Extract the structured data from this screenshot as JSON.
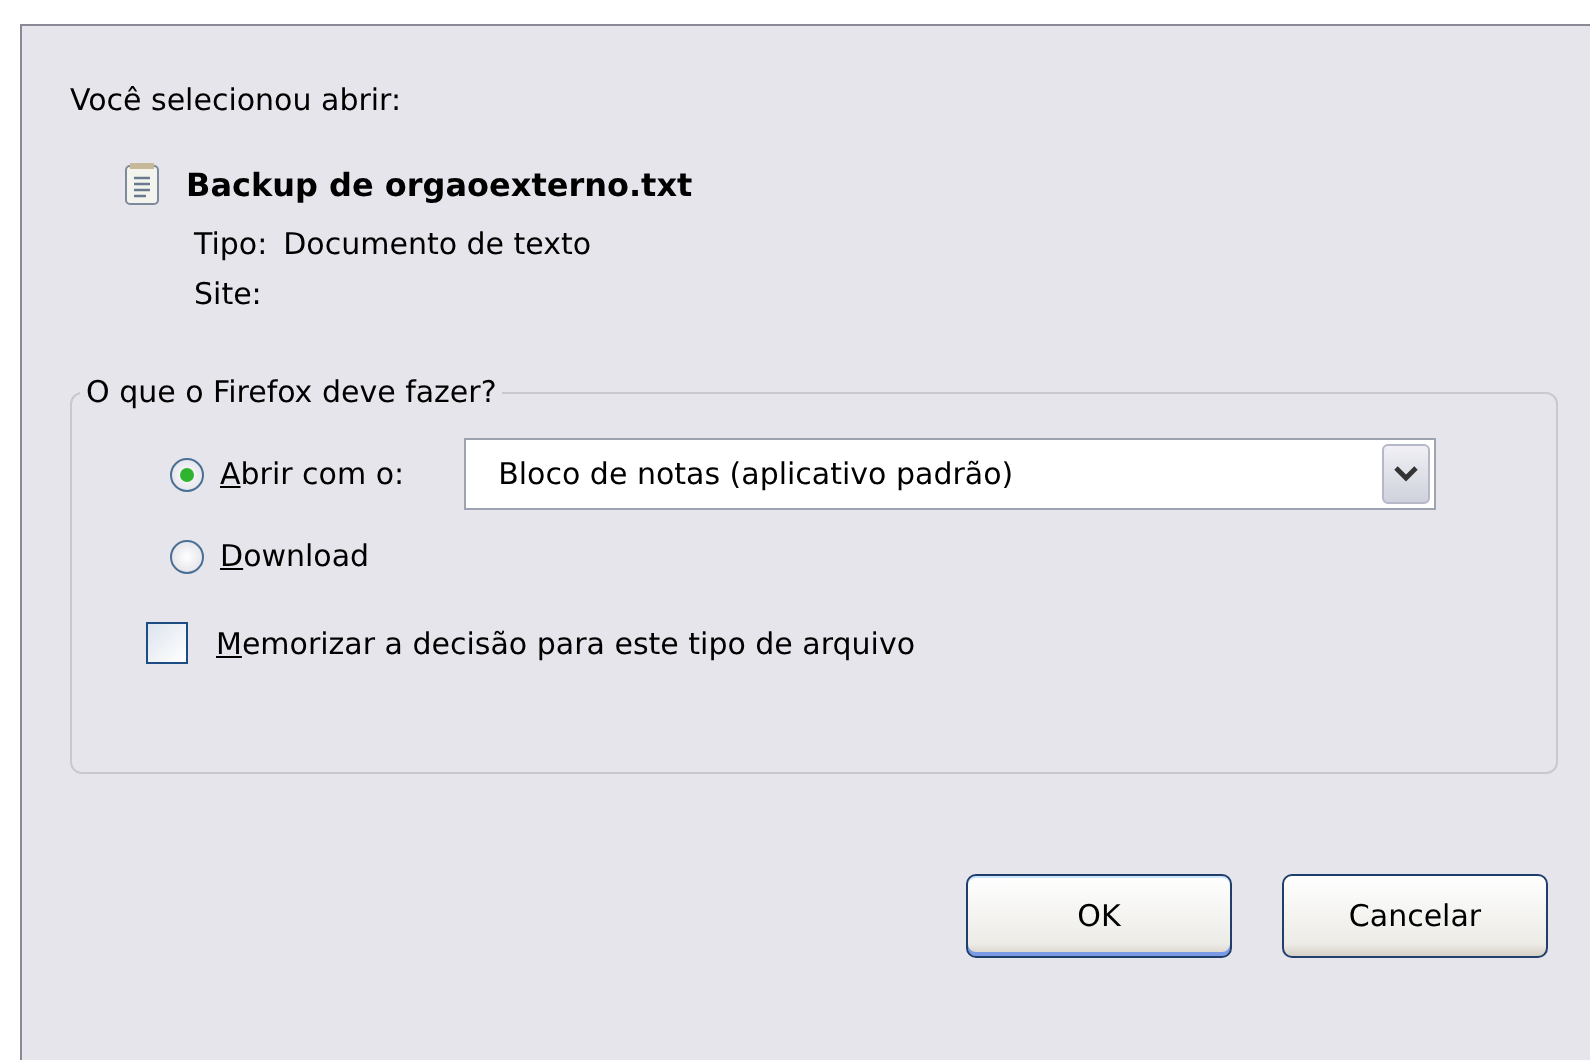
{
  "intro": "Você selecionou abrir:",
  "file": {
    "name": "Backup de orgaoexterno.txt",
    "type_label": "Tipo:",
    "type_value": "Documento de texto",
    "site_label": "Site:"
  },
  "action_group": {
    "legend": "O que o Firefox deve fazer?",
    "options": [
      {
        "kind": "radio",
        "label": "Abrir com o:",
        "access_key": true,
        "selected": true,
        "app": "Bloco de notas (aplicativo padrão)"
      },
      {
        "kind": "radio",
        "label": "Download",
        "access_key": true,
        "selected": false
      },
      {
        "kind": "checkbox",
        "label": "Memorizar a decisão para este tipo de arquivo",
        "access_key": true,
        "checked": false
      }
    ]
  },
  "buttons": [
    {
      "label": "OK",
      "default": true
    },
    {
      "label": "Cancelar",
      "default": false
    }
  ]
}
